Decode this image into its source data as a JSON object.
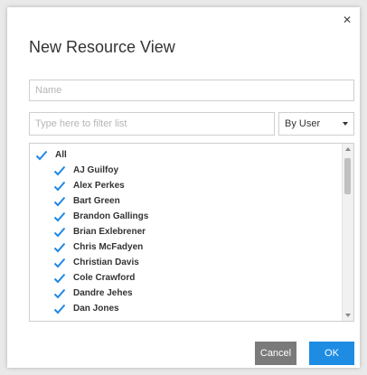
{
  "dialog": {
    "title": "New Resource View",
    "close_icon": "close-icon"
  },
  "name_field": {
    "placeholder": "Name",
    "value": ""
  },
  "filter_field": {
    "placeholder": "Type here to filter list",
    "value": ""
  },
  "group_select": {
    "selected": "By User"
  },
  "list": {
    "all_label": "All",
    "all_checked": true,
    "items": [
      {
        "label": "AJ Guilfoy",
        "checked": true
      },
      {
        "label": "Alex Perkes",
        "checked": true
      },
      {
        "label": "Bart Green",
        "checked": true
      },
      {
        "label": "Brandon Gallings",
        "checked": true
      },
      {
        "label": "Brian Exlebrener",
        "checked": true
      },
      {
        "label": "Chris McFadyen",
        "checked": true
      },
      {
        "label": "Christian Davis",
        "checked": true
      },
      {
        "label": "Cole Crawford",
        "checked": true
      },
      {
        "label": "Dandre Jehes",
        "checked": true
      },
      {
        "label": "Dan Jones",
        "checked": true
      }
    ]
  },
  "buttons": {
    "cancel": "Cancel",
    "ok": "OK"
  },
  "colors": {
    "accent": "#1e8ce3",
    "checkmark": "#1e88e5",
    "cancel_bg": "#7a7a7a"
  }
}
